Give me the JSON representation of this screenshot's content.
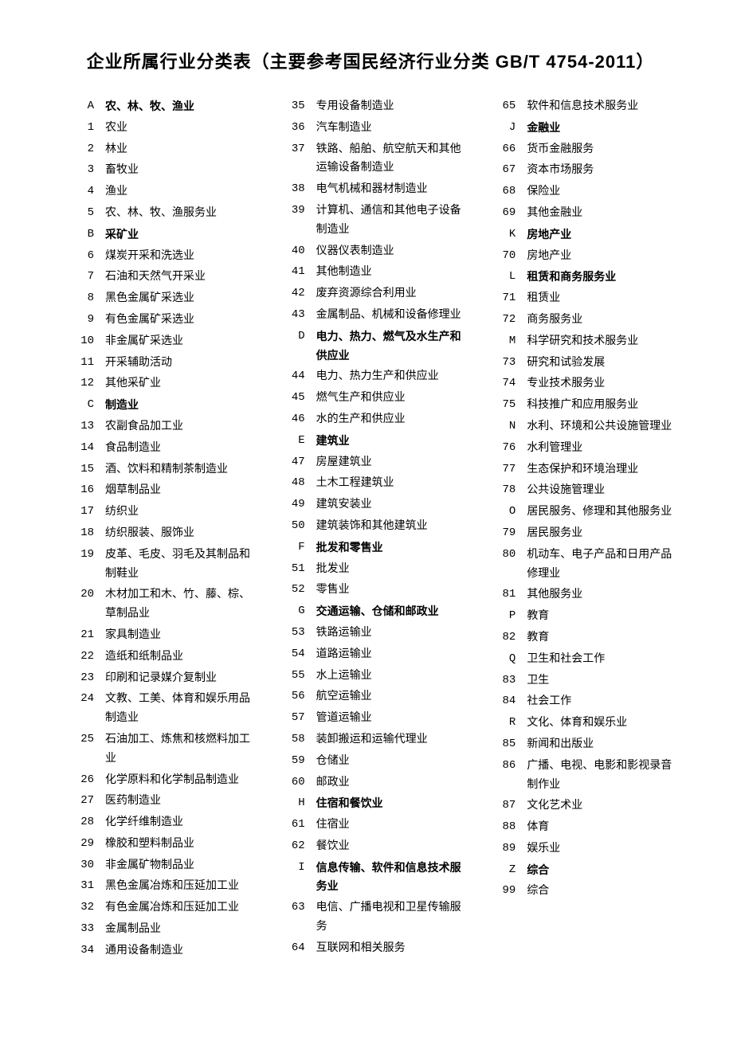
{
  "title": "企业所属行业分类表（主要参考国民经济行业分类 GB/T 4754-2011）",
  "rows": [
    {
      "code": "A",
      "name": "农、林、牧、渔业",
      "bold": true
    },
    {
      "code": "1",
      "name": "农业"
    },
    {
      "code": "2",
      "name": "林业"
    },
    {
      "code": "3",
      "name": "畜牧业"
    },
    {
      "code": "4",
      "name": "渔业"
    },
    {
      "code": "5",
      "name": "农、林、牧、渔服务业"
    },
    {
      "code": "B",
      "name": "采矿业",
      "bold": true
    },
    {
      "code": "6",
      "name": "煤炭开采和洗选业"
    },
    {
      "code": "7",
      "name": "石油和天然气开采业"
    },
    {
      "code": "8",
      "name": "黑色金属矿采选业"
    },
    {
      "code": "9",
      "name": "有色金属矿采选业"
    },
    {
      "code": "10",
      "name": "非金属矿采选业"
    },
    {
      "code": "11",
      "name": "开采辅助活动"
    },
    {
      "code": "12",
      "name": "其他采矿业"
    },
    {
      "code": "C",
      "name": "制造业",
      "bold": true
    },
    {
      "code": "13",
      "name": "农副食品加工业"
    },
    {
      "code": "14",
      "name": "食品制造业"
    },
    {
      "code": "15",
      "name": "酒、饮料和精制茶制造业"
    },
    {
      "code": "16",
      "name": "烟草制品业"
    },
    {
      "code": "17",
      "name": "纺织业"
    },
    {
      "code": "18",
      "name": "纺织服装、服饰业"
    },
    {
      "code": "19",
      "name": "皮革、毛皮、羽毛及其制品和制鞋业"
    },
    {
      "code": "20",
      "name": "木材加工和木、竹、藤、棕、草制品业"
    },
    {
      "code": "21",
      "name": "家具制造业"
    },
    {
      "code": "22",
      "name": "造纸和纸制品业"
    },
    {
      "code": "23",
      "name": "印刷和记录媒介复制业"
    },
    {
      "code": "24",
      "name": "文教、工美、体育和娱乐用品制造业"
    },
    {
      "code": "25",
      "name": "石油加工、炼焦和核燃料加工业"
    },
    {
      "code": "26",
      "name": "化学原料和化学制品制造业"
    },
    {
      "code": "27",
      "name": "医药制造业"
    },
    {
      "code": "28",
      "name": "化学纤维制造业"
    },
    {
      "code": "29",
      "name": "橡胶和塑料制品业"
    },
    {
      "code": "30",
      "name": "非金属矿物制品业"
    },
    {
      "code": "31",
      "name": "黑色金属冶炼和压延加工业"
    },
    {
      "code": "32",
      "name": "有色金属冶炼和压延加工业"
    },
    {
      "code": "33",
      "name": "金属制品业"
    },
    {
      "code": "34",
      "name": "通用设备制造业"
    },
    {
      "code": "35",
      "name": "专用设备制造业"
    },
    {
      "code": "36",
      "name": "汽车制造业"
    },
    {
      "code": "37",
      "name": "铁路、船舶、航空航天和其他运输设备制造业"
    },
    {
      "code": "38",
      "name": "电气机械和器材制造业"
    },
    {
      "code": "39",
      "name": "计算机、通信和其他电子设备制造业"
    },
    {
      "code": "40",
      "name": "仪器仪表制造业"
    },
    {
      "code": "41",
      "name": "其他制造业"
    },
    {
      "code": "42",
      "name": "废弃资源综合利用业"
    },
    {
      "code": "43",
      "name": "金属制品、机械和设备修理业"
    },
    {
      "code": "D",
      "name": "电力、热力、燃气及水生产和供应业",
      "bold": true
    },
    {
      "code": "44",
      "name": "电力、热力生产和供应业"
    },
    {
      "code": "45",
      "name": "燃气生产和供应业"
    },
    {
      "code": "46",
      "name": "水的生产和供应业"
    },
    {
      "code": "E",
      "name": "建筑业",
      "bold": true
    },
    {
      "code": "47",
      "name": "房屋建筑业"
    },
    {
      "code": "48",
      "name": "土木工程建筑业"
    },
    {
      "code": "49",
      "name": "建筑安装业"
    },
    {
      "code": "50",
      "name": "建筑装饰和其他建筑业"
    },
    {
      "code": "F",
      "name": "批发和零售业",
      "bold": true
    },
    {
      "code": "51",
      "name": "批发业"
    },
    {
      "code": "52",
      "name": "零售业"
    },
    {
      "code": "G",
      "name": "交通运输、仓储和邮政业",
      "bold": true
    },
    {
      "code": "53",
      "name": "铁路运输业"
    },
    {
      "code": "54",
      "name": "道路运输业"
    },
    {
      "code": "55",
      "name": "水上运输业"
    },
    {
      "code": "56",
      "name": "航空运输业"
    },
    {
      "code": "57",
      "name": "管道运输业"
    },
    {
      "code": "58",
      "name": "装卸搬运和运输代理业"
    },
    {
      "code": "59",
      "name": "仓储业"
    },
    {
      "code": "60",
      "name": "邮政业"
    },
    {
      "code": "H",
      "name": "住宿和餐饮业",
      "bold": true
    },
    {
      "code": "61",
      "name": "住宿业"
    },
    {
      "code": "62",
      "name": "餐饮业"
    },
    {
      "code": "I",
      "name": "信息传输、软件和信息技术服务业",
      "bold": true
    },
    {
      "code": "63",
      "name": "电信、广播电视和卫星传输服务"
    },
    {
      "code": "64",
      "name": "互联网和相关服务"
    },
    {
      "code": "65",
      "name": "软件和信息技术服务业"
    },
    {
      "code": "J",
      "name": "金融业",
      "bold": true
    },
    {
      "code": "66",
      "name": "货币金融服务"
    },
    {
      "code": "67",
      "name": "资本市场服务"
    },
    {
      "code": "68",
      "name": "保险业"
    },
    {
      "code": "69",
      "name": "其他金融业"
    },
    {
      "code": "K",
      "name": "房地产业",
      "bold": true
    },
    {
      "code": "70",
      "name": "房地产业"
    },
    {
      "code": "L",
      "name": "租赁和商务服务业",
      "bold": true
    },
    {
      "code": "71",
      "name": "租赁业"
    },
    {
      "code": "72",
      "name": "商务服务业"
    },
    {
      "code": "M",
      "name": "科学研究和技术服务业"
    },
    {
      "code": "73",
      "name": "研究和试验发展"
    },
    {
      "code": "74",
      "name": "专业技术服务业"
    },
    {
      "code": "75",
      "name": "科技推广和应用服务业"
    },
    {
      "code": "N",
      "name": "水利、环境和公共设施管理业"
    },
    {
      "code": "76",
      "name": "水利管理业"
    },
    {
      "code": "77",
      "name": "生态保护和环境治理业"
    },
    {
      "code": "78",
      "name": "公共设施管理业"
    },
    {
      "code": "O",
      "name": "居民服务、修理和其他服务业"
    },
    {
      "code": "79",
      "name": "居民服务业"
    },
    {
      "code": "80",
      "name": "机动车、电子产品和日用产品修理业"
    },
    {
      "code": "81",
      "name": "其他服务业"
    },
    {
      "code": "P",
      "name": "教育"
    },
    {
      "code": "82",
      "name": "教育"
    },
    {
      "code": "Q",
      "name": "卫生和社会工作"
    },
    {
      "code": "83",
      "name": "卫生"
    },
    {
      "code": "84",
      "name": "社会工作"
    },
    {
      "code": "R",
      "name": "文化、体育和娱乐业"
    },
    {
      "code": "85",
      "name": "新闻和出版业"
    },
    {
      "code": "86",
      "name": "广播、电视、电影和影视录音制作业"
    },
    {
      "code": "87",
      "name": "文化艺术业"
    },
    {
      "code": "88",
      "name": "体育"
    },
    {
      "code": "89",
      "name": "娱乐业"
    },
    {
      "code": "Z",
      "name": "综合",
      "bold": true
    },
    {
      "code": "99",
      "name": "综合"
    }
  ]
}
